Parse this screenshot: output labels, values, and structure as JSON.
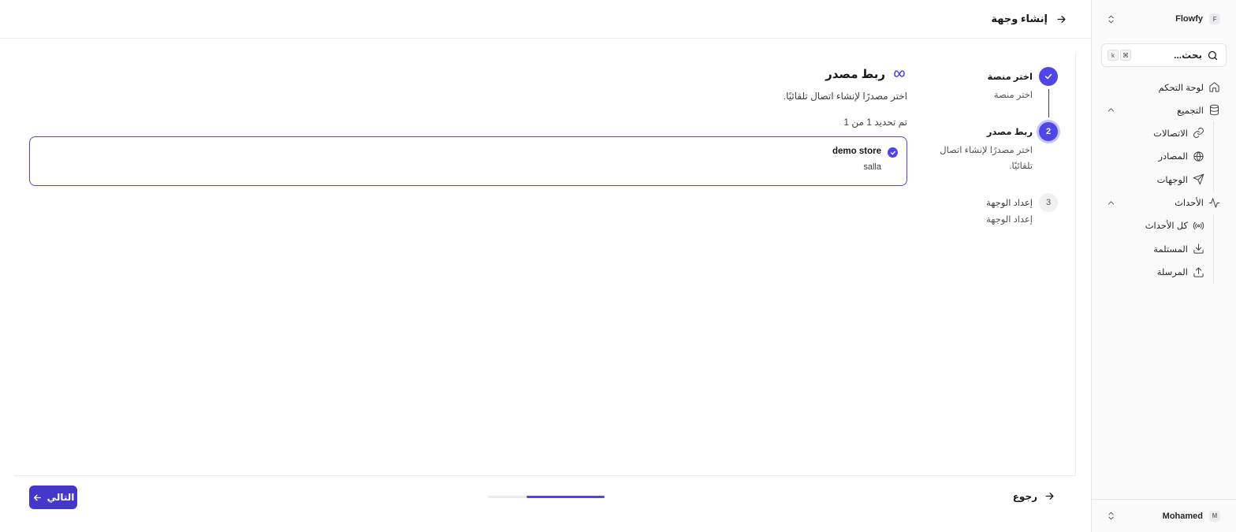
{
  "workspace": {
    "initial": "F",
    "name": "Flowfy"
  },
  "search": {
    "label": "بحث...",
    "shortcut": [
      "⌘",
      "k"
    ]
  },
  "sidebar": {
    "items": [
      {
        "label": "لوحة التحكم",
        "icon": "home-icon"
      },
      {
        "label": "التجميع",
        "icon": "database-icon",
        "expanded": true,
        "children": [
          {
            "label": "الاتصالات",
            "icon": "link-icon"
          },
          {
            "label": "المصادر",
            "icon": "globe-icon"
          },
          {
            "label": "الوجهات",
            "icon": "send-icon"
          }
        ]
      },
      {
        "label": "الأحداث",
        "icon": "activity-icon",
        "expanded": true,
        "children": [
          {
            "label": "كل الأحداث",
            "icon": "radio-icon"
          },
          {
            "label": "المستلمة",
            "icon": "download-icon"
          },
          {
            "label": "المرسلة",
            "icon": "upload-icon"
          }
        ]
      }
    ]
  },
  "user": {
    "initial": "M",
    "name": "Mohamed"
  },
  "header": {
    "title": "إنشاء وجهة"
  },
  "stepper": {
    "steps": [
      {
        "title": "اختر منصة",
        "desc": "اختر منصة",
        "state": "done"
      },
      {
        "number": "2",
        "title": "ربط مصدر",
        "desc": "اختر مصدرًا لإنشاء اتصال تلقائيًا.",
        "state": "active"
      },
      {
        "number": "3",
        "title": "إعداد الوجهة",
        "desc": "إعداد الوجهة",
        "state": "idle"
      }
    ]
  },
  "content": {
    "title": "ربط مصدر",
    "subtitle": "اختر مصدرًا لإنشاء اتصال تلقائيًا.",
    "selected_count": "تم تحديد 1 من 1",
    "sources": [
      {
        "name": "demo store",
        "platform": "salla",
        "selected": true
      }
    ]
  },
  "footer": {
    "back_label": "رجوع",
    "next_label": "التالي",
    "progress": 0.67
  },
  "colors": {
    "accent": "#4f46e5"
  }
}
